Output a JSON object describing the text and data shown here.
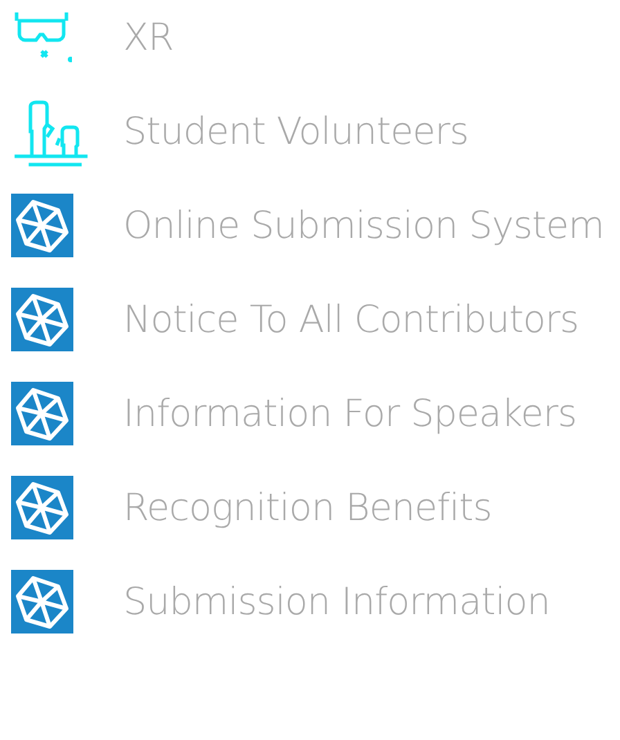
{
  "links": [
    {
      "kind": "headset",
      "label": "XR"
    },
    {
      "kind": "hands",
      "label": "Student Volunteers"
    },
    {
      "kind": "cube",
      "label": "Online Submission System"
    },
    {
      "kind": "cube",
      "label": "Notice To All Contributors"
    },
    {
      "kind": "cube",
      "label": "Information For Speakers"
    },
    {
      "kind": "cube",
      "label": "Recognition Benefits"
    },
    {
      "kind": "cube",
      "label": "Submission Information"
    }
  ]
}
